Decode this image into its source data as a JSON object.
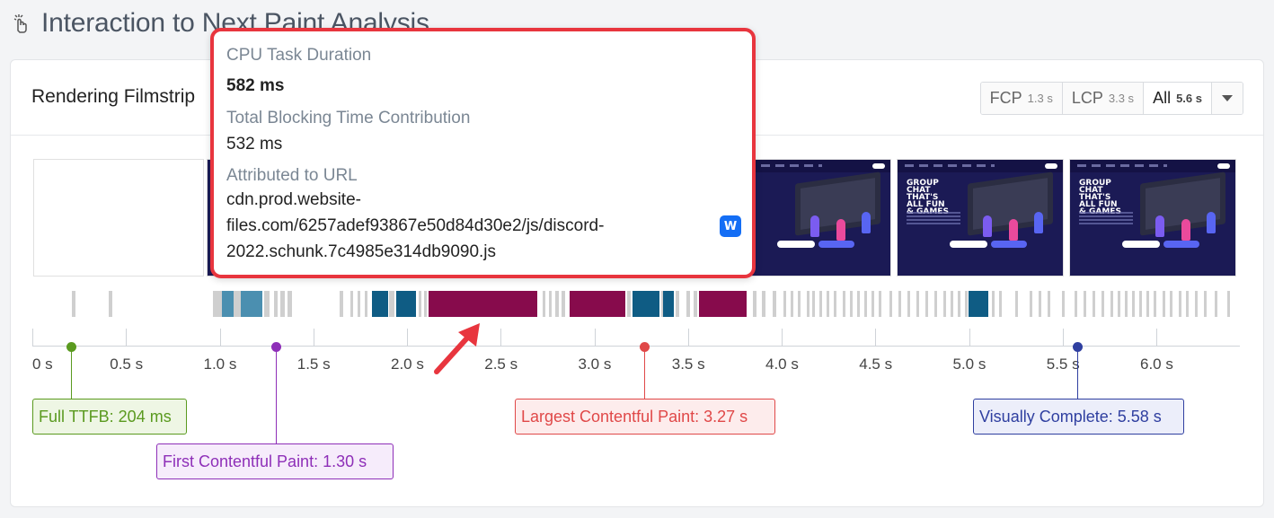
{
  "page": {
    "title": "Interaction to Next Paint Analysis",
    "title_icon": "pointer-tap-icon"
  },
  "card": {
    "title": "Rendering Filmstrip",
    "range_options": [
      {
        "label": "FCP",
        "value": "1.3 s"
      },
      {
        "label": "LCP",
        "value": "3.3 s"
      },
      {
        "label": "All",
        "value": "5.6 s",
        "selected": true
      }
    ],
    "dropdown_icon": "chevron-down-icon"
  },
  "filmstrip": {
    "frame_heading": "GROUP CHAT THAT'S ALL FUN & GAMES",
    "frame_nav_label": "Discord"
  },
  "timeline": {
    "ticks": [
      "0 s",
      "0.5 s",
      "1.0 s",
      "1.5 s",
      "2.0 s",
      "2.5 s",
      "3.0 s",
      "3.5 s",
      "4.0 s",
      "4.5 s",
      "5.0 s",
      "5.5 s",
      "6.0 s"
    ],
    "markers": [
      {
        "label": "Full TTFB: 204 ms",
        "time_s": 0.204,
        "color": "#5a9a1f"
      },
      {
        "label": "First Contentful Paint: 1.30 s",
        "time_s": 1.3,
        "color": "#8e2fb8"
      },
      {
        "label": "Largest Contentful Paint: 3.27 s",
        "time_s": 3.27,
        "color": "#e04848"
      },
      {
        "label": "Visually Complete: 5.58 s",
        "time_s": 5.58,
        "color": "#2f3fa0"
      }
    ]
  },
  "tooltip": {
    "cpu_label": "CPU Task Duration",
    "cpu_value": "582 ms",
    "tbt_label": "Total Blocking Time Contribution",
    "tbt_value": "532 ms",
    "url_label": "Attributed to URL",
    "url_value": "cdn.prod.website-files.com/6257adef93867e50d84d30e2/js/discord-2022.schunk.7c4985e314db9090.js",
    "badge_icon": "webflow-icon",
    "badge_text": "W"
  },
  "colors": {
    "long_task": "#870b4c",
    "task_blue": "#0f5c84",
    "task_light_blue": "#4b8fb0",
    "task_gray": "#cfcfcf",
    "highlight_border": "#e8353e"
  }
}
